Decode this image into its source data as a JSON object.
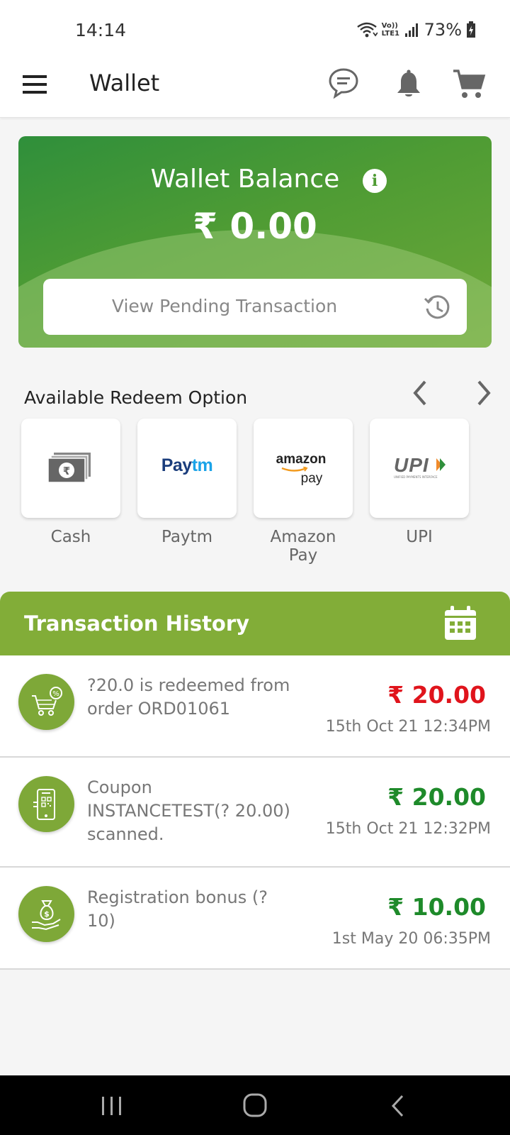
{
  "status_bar": {
    "time": "14:14",
    "network_label": "Vo)) LTE1",
    "battery": "73%"
  },
  "app_bar": {
    "title": "Wallet",
    "icons": [
      "menu-icon",
      "chat-icon",
      "bell-icon",
      "cart-icon"
    ]
  },
  "balance": {
    "title": "Wallet Balance",
    "amount": "₹ 0.00",
    "pending_label": "View Pending Transaction"
  },
  "redeem": {
    "header": "Available Redeem Option",
    "options": [
      {
        "label": "Cash",
        "logo_text": ""
      },
      {
        "label": "Paytm",
        "logo_text": "Paytm"
      },
      {
        "label": "Amazon Pay",
        "logo_text": "amazon pay"
      },
      {
        "label": "UPI",
        "logo_text": "UPI",
        "logo_subtext": "UNIFIED PAYMENTS INTERFACE"
      }
    ]
  },
  "history": {
    "title": "Transaction History",
    "transactions": [
      {
        "description": "?20.0 is redeemed from order ORD01061",
        "amount": "₹ 20.00",
        "date": "15th Oct 21 12:34PM",
        "type": "debit",
        "icon": "cart-discount-icon"
      },
      {
        "description": "Coupon INSTANCETEST(? 20.00) scanned.",
        "amount": "₹ 20.00",
        "date": "15th Oct 21 12:32PM",
        "type": "credit",
        "icon": "phone-qr-icon"
      },
      {
        "description": "Registration bonus (? 10)",
        "amount": "₹ 10.00",
        "date": "1st May 20 06:35PM",
        "type": "credit",
        "icon": "money-bag-hand-icon"
      }
    ]
  },
  "colors": {
    "accent_green": "#82ad38",
    "debit_red": "#e0141c",
    "credit_green": "#1e8a2a"
  }
}
